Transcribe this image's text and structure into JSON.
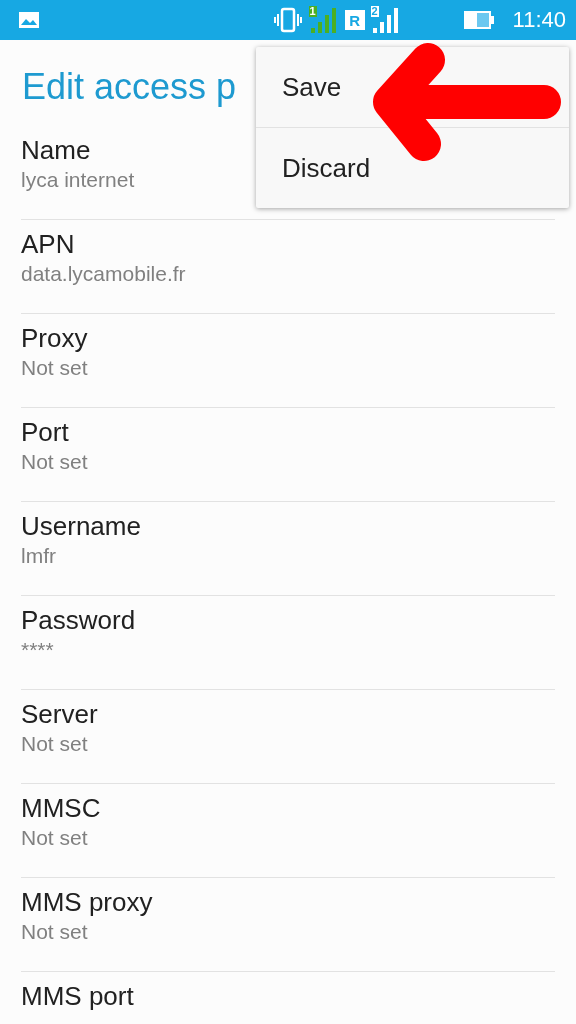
{
  "status_bar": {
    "sim1_label": "1",
    "roaming": "R",
    "sim2_label": "2",
    "time": "11:40"
  },
  "title": "Edit access p",
  "fields": [
    {
      "label": "Name",
      "value": "lyca internet"
    },
    {
      "label": "APN",
      "value": "data.lycamobile.fr"
    },
    {
      "label": "Proxy",
      "value": "Not set"
    },
    {
      "label": "Port",
      "value": "Not set"
    },
    {
      "label": "Username",
      "value": "lmfr"
    },
    {
      "label": "Password",
      "value": "****"
    },
    {
      "label": "Server",
      "value": "Not set"
    },
    {
      "label": "MMSC",
      "value": "Not set"
    },
    {
      "label": "MMS proxy",
      "value": "Not set"
    },
    {
      "label": "MMS port"
    }
  ],
  "menu": {
    "items": [
      "Save",
      "Discard"
    ]
  }
}
